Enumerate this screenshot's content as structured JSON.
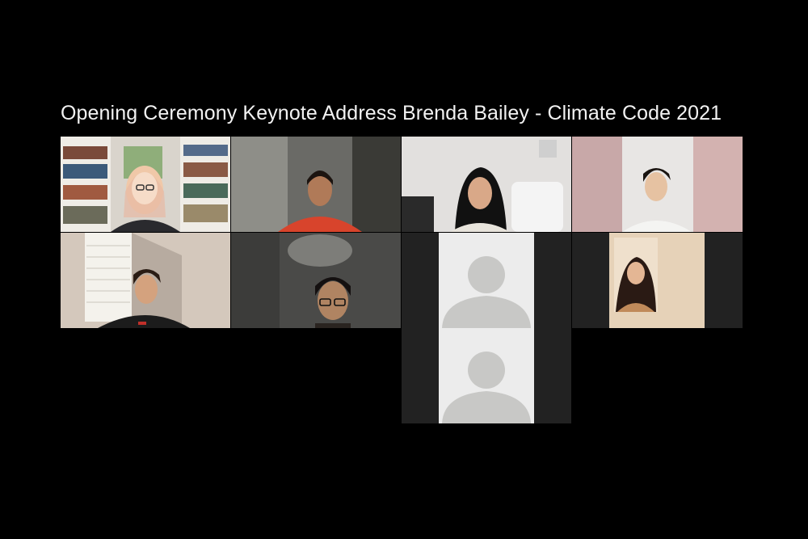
{
  "meeting": {
    "title": "Opening Ceremony Keynote Address Brenda Bailey - Climate Code 2021"
  },
  "participants": [
    {
      "tile": "video",
      "description": "woman-with-glasses-bookshelf"
    },
    {
      "tile": "video",
      "description": "person-red-shirt-blurred"
    },
    {
      "tile": "video",
      "description": "girl-dark-hair-white-room"
    },
    {
      "tile": "video",
      "description": "boy-white-shirt-pink-room"
    },
    {
      "tile": "video",
      "description": "girl-black-shirt-window"
    },
    {
      "tile": "video",
      "description": "boy-glasses-dim-room"
    },
    {
      "tile": "no-video",
      "icon": "person-placeholder-icon"
    },
    {
      "tile": "video-small",
      "description": "girl-long-hair"
    },
    {
      "tile": "no-video",
      "icon": "person-placeholder-icon"
    }
  ],
  "colors": {
    "background": "#000000",
    "title_text": "#f2f2f2",
    "placeholder_bg": "#ececec",
    "placeholder_figure": "#c8c8c6",
    "tile_dark": "#222222"
  }
}
